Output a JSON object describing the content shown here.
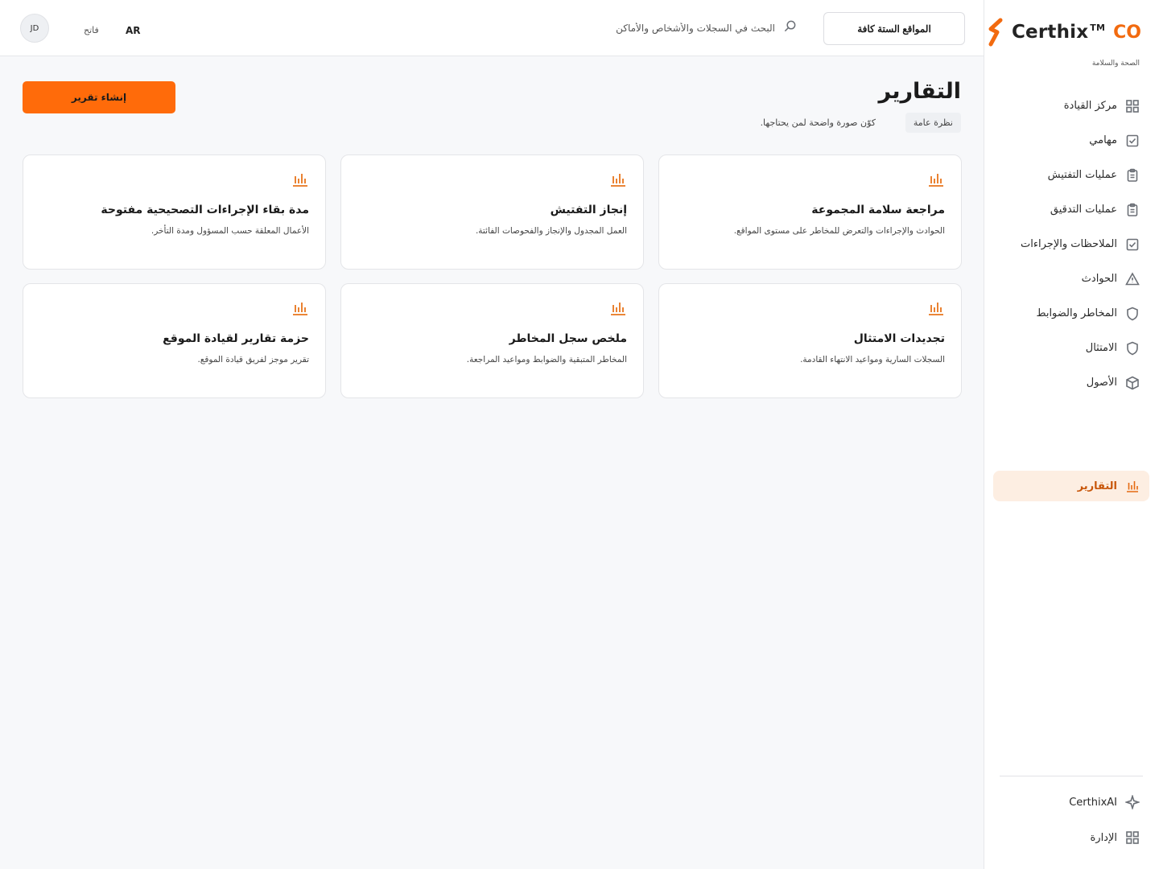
{
  "brand": {
    "name": "Certhix",
    "tm": "TM",
    "suffix": "CO",
    "tagline": "الصحة والسلامة",
    "accent_color": "#f26a0f"
  },
  "sidebar": {
    "items": [
      {
        "label": "مركز القيادة",
        "icon": "grid-icon"
      },
      {
        "label": "مهامي",
        "icon": "checkbox-icon"
      },
      {
        "label": "عمليات التفتيش",
        "icon": "clipboard-icon"
      },
      {
        "label": "عمليات التدقيق",
        "icon": "clipboard-icon"
      },
      {
        "label": "الملاحظات والإجراءات",
        "icon": "checkbox-icon"
      },
      {
        "label": "الحوادث",
        "icon": "warning-icon"
      },
      {
        "label": "المخاطر والضوابط",
        "icon": "shield-icon"
      },
      {
        "label": "الامتثال",
        "icon": "shield-icon"
      },
      {
        "label": "الأصول",
        "icon": "cube-icon"
      }
    ],
    "active": {
      "label": "التقارير",
      "icon": "bar-chart-icon"
    },
    "bottom": [
      {
        "label": "CerthixAI",
        "icon": "sparkle-icon"
      },
      {
        "label": "الإدارة",
        "icon": "grid-icon"
      }
    ]
  },
  "topbar": {
    "sites_button": "المواقع الستة كافة",
    "search_placeholder": "البحث في السجلات والأشخاص والأماكن",
    "language": "AR",
    "theme": "فاتح",
    "avatar_initials": "JD"
  },
  "page": {
    "title": "التقارير",
    "chip": "نظرة عامة",
    "subtitle": "كوّن صورة واضحة لمن يحتاجها.",
    "create_button": "إنشاء تقرير"
  },
  "cards": [
    {
      "title": "مراجعة سلامة المجموعة",
      "desc": "الحوادث والإجراءات والتعرض للمخاطر على مستوى المواقع.",
      "icon": "bar-chart-icon"
    },
    {
      "title": "إنجاز التفتيش",
      "desc": "العمل المجدول والإنجاز والفحوصات الفائتة.",
      "icon": "bar-chart-icon"
    },
    {
      "title": "مدة بقاء الإجراءات التصحيحية مفتوحة",
      "desc": "الأعمال المعلقة حسب المسؤول ومدة التأخر.",
      "icon": "bar-chart-icon"
    },
    {
      "title": "تجديدات الامتثال",
      "desc": "السجلات السارية ومواعيد الانتهاء القادمة.",
      "icon": "bar-chart-icon"
    },
    {
      "title": "ملخص سجل المخاطر",
      "desc": "المخاطر المتبقية والضوابط ومواعيد المراجعة.",
      "icon": "bar-chart-icon"
    },
    {
      "title": "حزمة تقارير لقيادة الموقع",
      "desc": "تقرير موجز لفريق قيادة الموقع.",
      "icon": "bar-chart-icon"
    }
  ]
}
